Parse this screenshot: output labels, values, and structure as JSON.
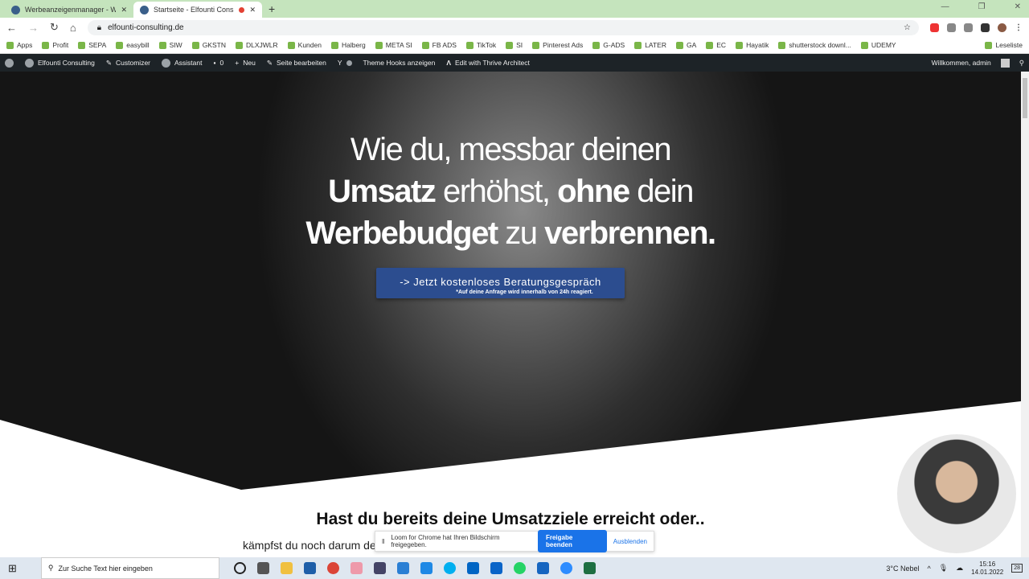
{
  "browser": {
    "tabs": [
      {
        "title": "Werbeanzeigenmanager - Werbe"
      },
      {
        "title": "Startseite - Elfounti Consultin"
      }
    ],
    "url": "elfounti-consulting.de",
    "bookmarks": [
      "Apps",
      "Profit",
      "SEPA",
      "easybill",
      "SIW",
      "GKSTN",
      "DLXJWLR",
      "Kunden",
      "Halberg",
      "META SI",
      "FB ADS",
      "TikTok",
      "SI",
      "Pinterest Ads",
      "G-ADS",
      "LATER",
      "GA",
      "EC",
      "Hayatik",
      "shutterstock downl...",
      "UDEMY",
      "Leseliste"
    ]
  },
  "wp_bar": {
    "site": "Elfounti Consulting",
    "customizer": "Customizer",
    "assistant": "Assistant",
    "comments": "0",
    "new": "Neu",
    "edit": "Seite bearbeiten",
    "hooks": "Theme Hooks anzeigen",
    "thrive": "Edit with Thrive Architect",
    "welcome": "Willkommen, admin"
  },
  "hero": {
    "line1": "Wie du, messbar deinen",
    "l2a": "Umsatz",
    "l2b": " erhöhst, ",
    "l2c": "ohne",
    "l2d": " dein",
    "l3a": "Werbebudget",
    "l3b": " zu ",
    "l3c": "verbrennen.",
    "cta": "-> Jetzt kostenloses Beratungsgespräch",
    "cta_sub": "*Auf deine Anfrage wird innerhalb von 24h reagiert."
  },
  "section": {
    "heading": "Hast du bereits deine Umsatzziele erreicht oder..",
    "text": "kämpfst du noch darum de"
  },
  "loom": {
    "message": "Loom for Chrome hat Ihren Bildschirm freigegeben.",
    "stop": "Freigabe beenden",
    "hide": "Ausblenden"
  },
  "taskbar": {
    "search": "Zur Suche Text hier eingeben",
    "weather": "3°C  Nebel",
    "time": "15:16",
    "date": "14.01.2022",
    "notifications": "28"
  }
}
